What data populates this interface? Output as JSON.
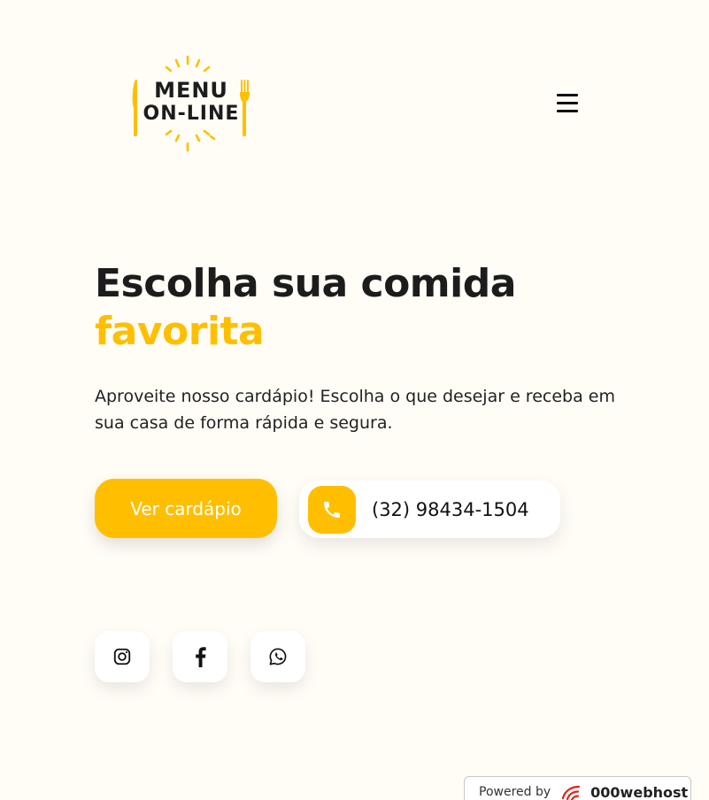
{
  "header": {
    "logo": {
      "line1": "MENU",
      "line2": "ON-LINE",
      "icon": "menu-online-logo"
    },
    "menu_icon": "hamburger-icon"
  },
  "hero": {
    "title_main": "Escolha sua comida",
    "title_accent": "favorita",
    "description": "Aproveite nosso cardápio! Escolha o que desejar e receba em sua casa de forma rápida e segura.",
    "cta_label": "Ver cardápio",
    "phone_number": "(32) 98434-1504",
    "phone_icon": "phone-icon"
  },
  "social": [
    {
      "name": "instagram",
      "icon": "instagram-icon"
    },
    {
      "name": "facebook",
      "icon": "facebook-icon"
    },
    {
      "name": "whatsapp",
      "icon": "whatsapp-icon"
    }
  ],
  "footer": {
    "powered_by": "Powered by",
    "brand": "000webhost"
  },
  "colors": {
    "background": "#fffdf6",
    "accent": "#ffbf00",
    "text": "#1c1c1c",
    "card": "#ffffff"
  }
}
